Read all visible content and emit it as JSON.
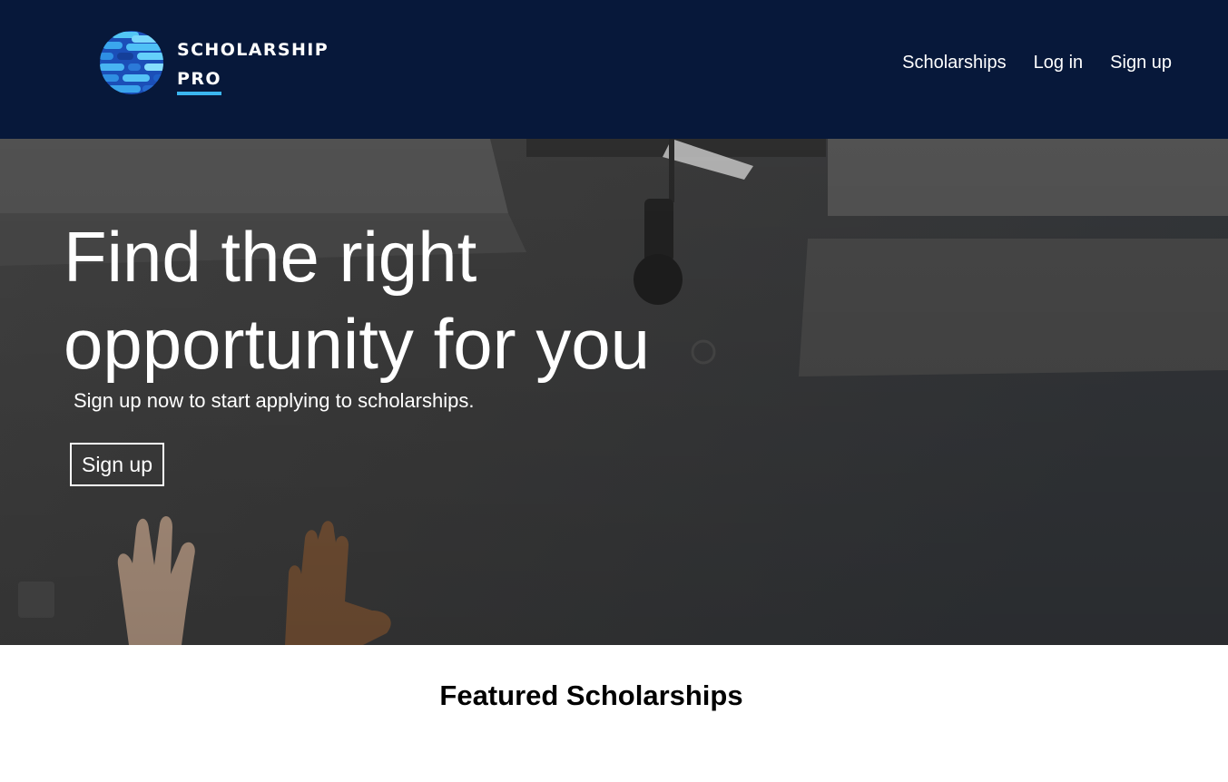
{
  "brand": {
    "line1": "SCHOLARSHIP",
    "line2": "PRO",
    "accent_color": "#3bb6f0",
    "header_bg": "#07183a"
  },
  "nav": {
    "items": [
      {
        "label": "Scholarships"
      },
      {
        "label": "Log in"
      },
      {
        "label": "Sign up"
      }
    ]
  },
  "hero": {
    "title_line1": "Find the right",
    "title_line2": "opportunity for you",
    "subtitle": "Sign up now to start applying to scholarships.",
    "cta_label": "Sign up"
  },
  "featured": {
    "title": "Featured Scholarships"
  }
}
